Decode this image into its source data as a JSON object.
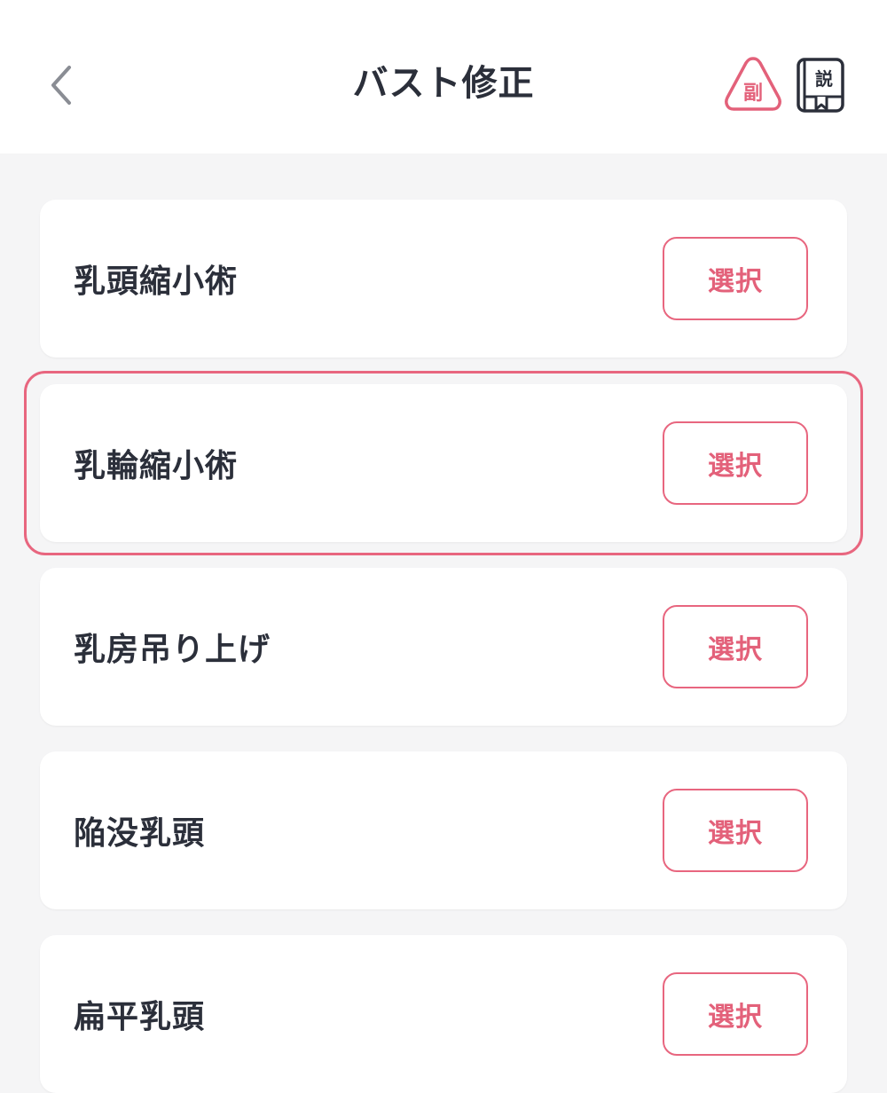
{
  "header": {
    "title": "バスト修正",
    "back_icon": "chevron-left-icon",
    "side_effect_icon": {
      "name": "side-effect-warning-icon",
      "glyph": "副",
      "color": "#e3617a"
    },
    "manual_icon": {
      "name": "manual-book-icon",
      "glyph": "説",
      "color": "#2b2f3a"
    }
  },
  "colors": {
    "accent": "#e8667f",
    "text": "#2b2f3a",
    "background": "#f5f5f6",
    "card": "#ffffff"
  },
  "items": [
    {
      "label": "乳頭縮小術",
      "button": "選択",
      "highlighted": false
    },
    {
      "label": "乳輪縮小術",
      "button": "選択",
      "highlighted": true
    },
    {
      "label": "乳房吊り上げ",
      "button": "選択",
      "highlighted": false
    },
    {
      "label": "陥没乳頭",
      "button": "選択",
      "highlighted": false
    },
    {
      "label": "扁平乳頭",
      "button": "選択",
      "highlighted": false
    }
  ]
}
